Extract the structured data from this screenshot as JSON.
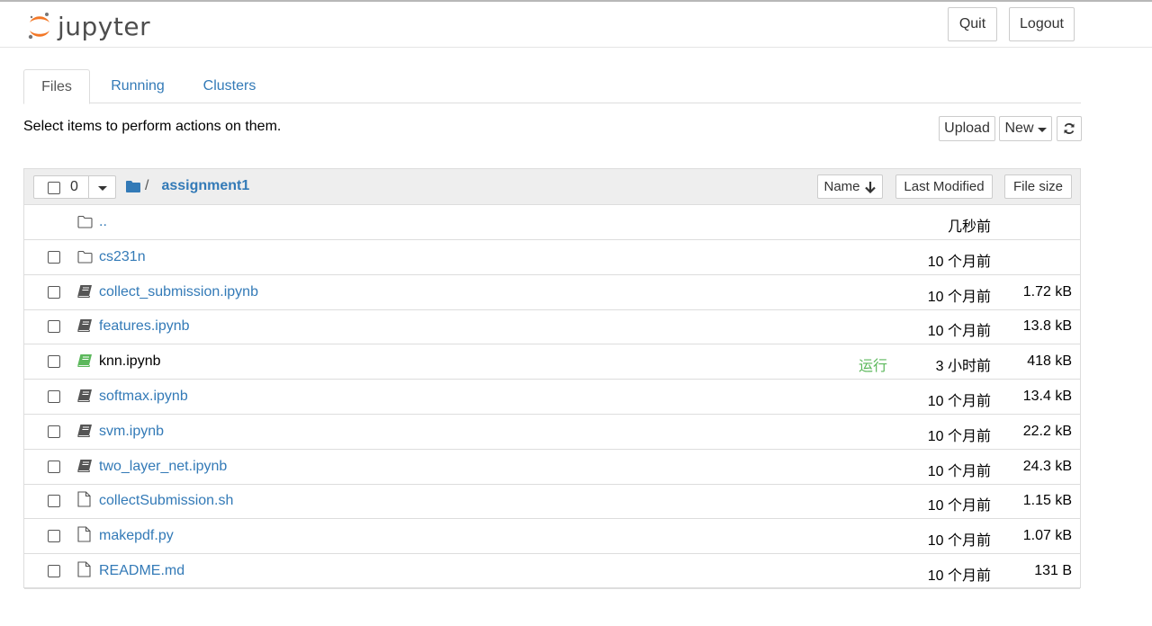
{
  "header": {
    "logo_text": "jupyter",
    "quit_label": "Quit",
    "logout_label": "Logout"
  },
  "tabs": [
    {
      "label": "Files",
      "active": true
    },
    {
      "label": "Running",
      "active": false
    },
    {
      "label": "Clusters",
      "active": false
    }
  ],
  "toolbar": {
    "hint": "Select items to perform actions on them.",
    "upload_label": "Upload",
    "new_label": "New"
  },
  "list_header": {
    "selected_count": "0",
    "path_sep": "/",
    "current_dir": "assignment1",
    "sort_name_label": "Name",
    "sort_modified_label": "Last Modified",
    "sort_size_label": "File size"
  },
  "files": [
    {
      "name": "..",
      "type": "parent",
      "modified": "几秒前",
      "size": "",
      "status": ""
    },
    {
      "name": "cs231n",
      "type": "folder",
      "modified": "10 个月前",
      "size": "",
      "status": ""
    },
    {
      "name": "collect_submission.ipynb",
      "type": "notebook",
      "modified": "10 个月前",
      "size": "1.72 kB",
      "status": ""
    },
    {
      "name": "features.ipynb",
      "type": "notebook",
      "modified": "10 个月前",
      "size": "13.8 kB",
      "status": ""
    },
    {
      "name": "knn.ipynb",
      "type": "notebook-running",
      "modified": "3 小时前",
      "size": "418 kB",
      "status": "运行"
    },
    {
      "name": "softmax.ipynb",
      "type": "notebook",
      "modified": "10 个月前",
      "size": "13.4 kB",
      "status": ""
    },
    {
      "name": "svm.ipynb",
      "type": "notebook",
      "modified": "10 个月前",
      "size": "22.2 kB",
      "status": ""
    },
    {
      "name": "two_layer_net.ipynb",
      "type": "notebook",
      "modified": "10 个月前",
      "size": "24.3 kB",
      "status": ""
    },
    {
      "name": "collectSubmission.sh",
      "type": "file",
      "modified": "10 个月前",
      "size": "1.15 kB",
      "status": ""
    },
    {
      "name": "makepdf.py",
      "type": "file",
      "modified": "10 个月前",
      "size": "1.07 kB",
      "status": ""
    },
    {
      "name": "README.md",
      "type": "file",
      "modified": "10 个月前",
      "size": "131 B",
      "status": ""
    }
  ],
  "colors": {
    "link": "#337ab7",
    "running": "#5cb85c",
    "logo_orange": "#f37726"
  }
}
